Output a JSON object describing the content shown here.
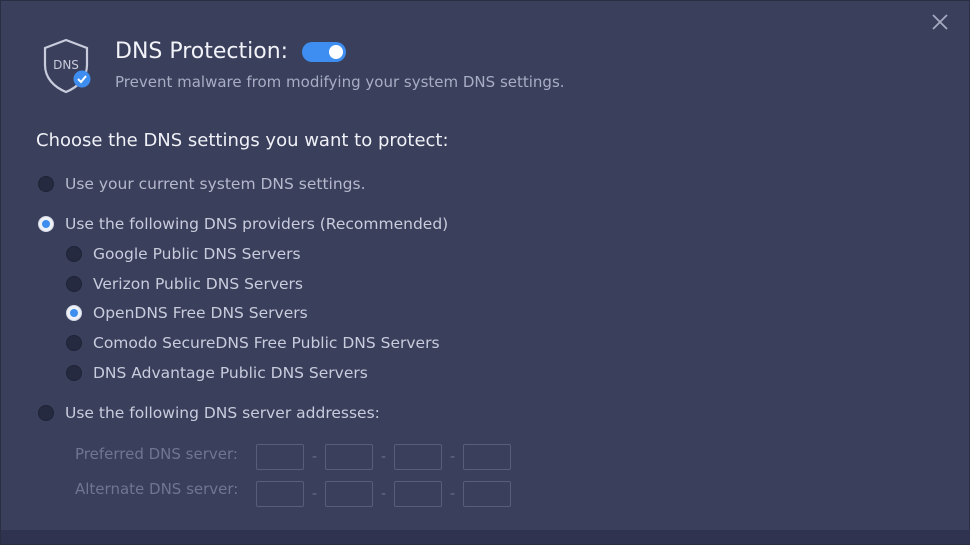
{
  "header": {
    "icon_text": "DNS",
    "title": "DNS Protection:",
    "toggle_on": true,
    "subtitle": "Prevent malware from modifying your system DNS settings."
  },
  "section": {
    "heading": "Choose the DNS settings you want to protect:"
  },
  "options": {
    "current": {
      "label": "Use your current system DNS settings.",
      "checked": false
    },
    "providers": {
      "label": "Use the following DNS providers (Recommended)",
      "checked": true
    },
    "addresses": {
      "label": "Use the following DNS server addresses:",
      "checked": false
    }
  },
  "providers": [
    {
      "label": "Google Public DNS Servers",
      "checked": false
    },
    {
      "label": "Verizon Public DNS Servers",
      "checked": false
    },
    {
      "label": "OpenDNS Free DNS Servers",
      "checked": true
    },
    {
      "label": "Comodo SecureDNS Free Public DNS Servers",
      "checked": false
    },
    {
      "label": "DNS Advantage Public DNS Servers",
      "checked": false
    }
  ],
  "fields": {
    "preferred_label": "Preferred DNS server:",
    "alternate_label": "Alternate DNS server:",
    "separator": "-"
  },
  "colors": {
    "background": "#3a3f5c",
    "accent": "#3d8ef0"
  },
  "icons": {
    "close": "close-icon",
    "shield": "dns-shield-icon"
  }
}
